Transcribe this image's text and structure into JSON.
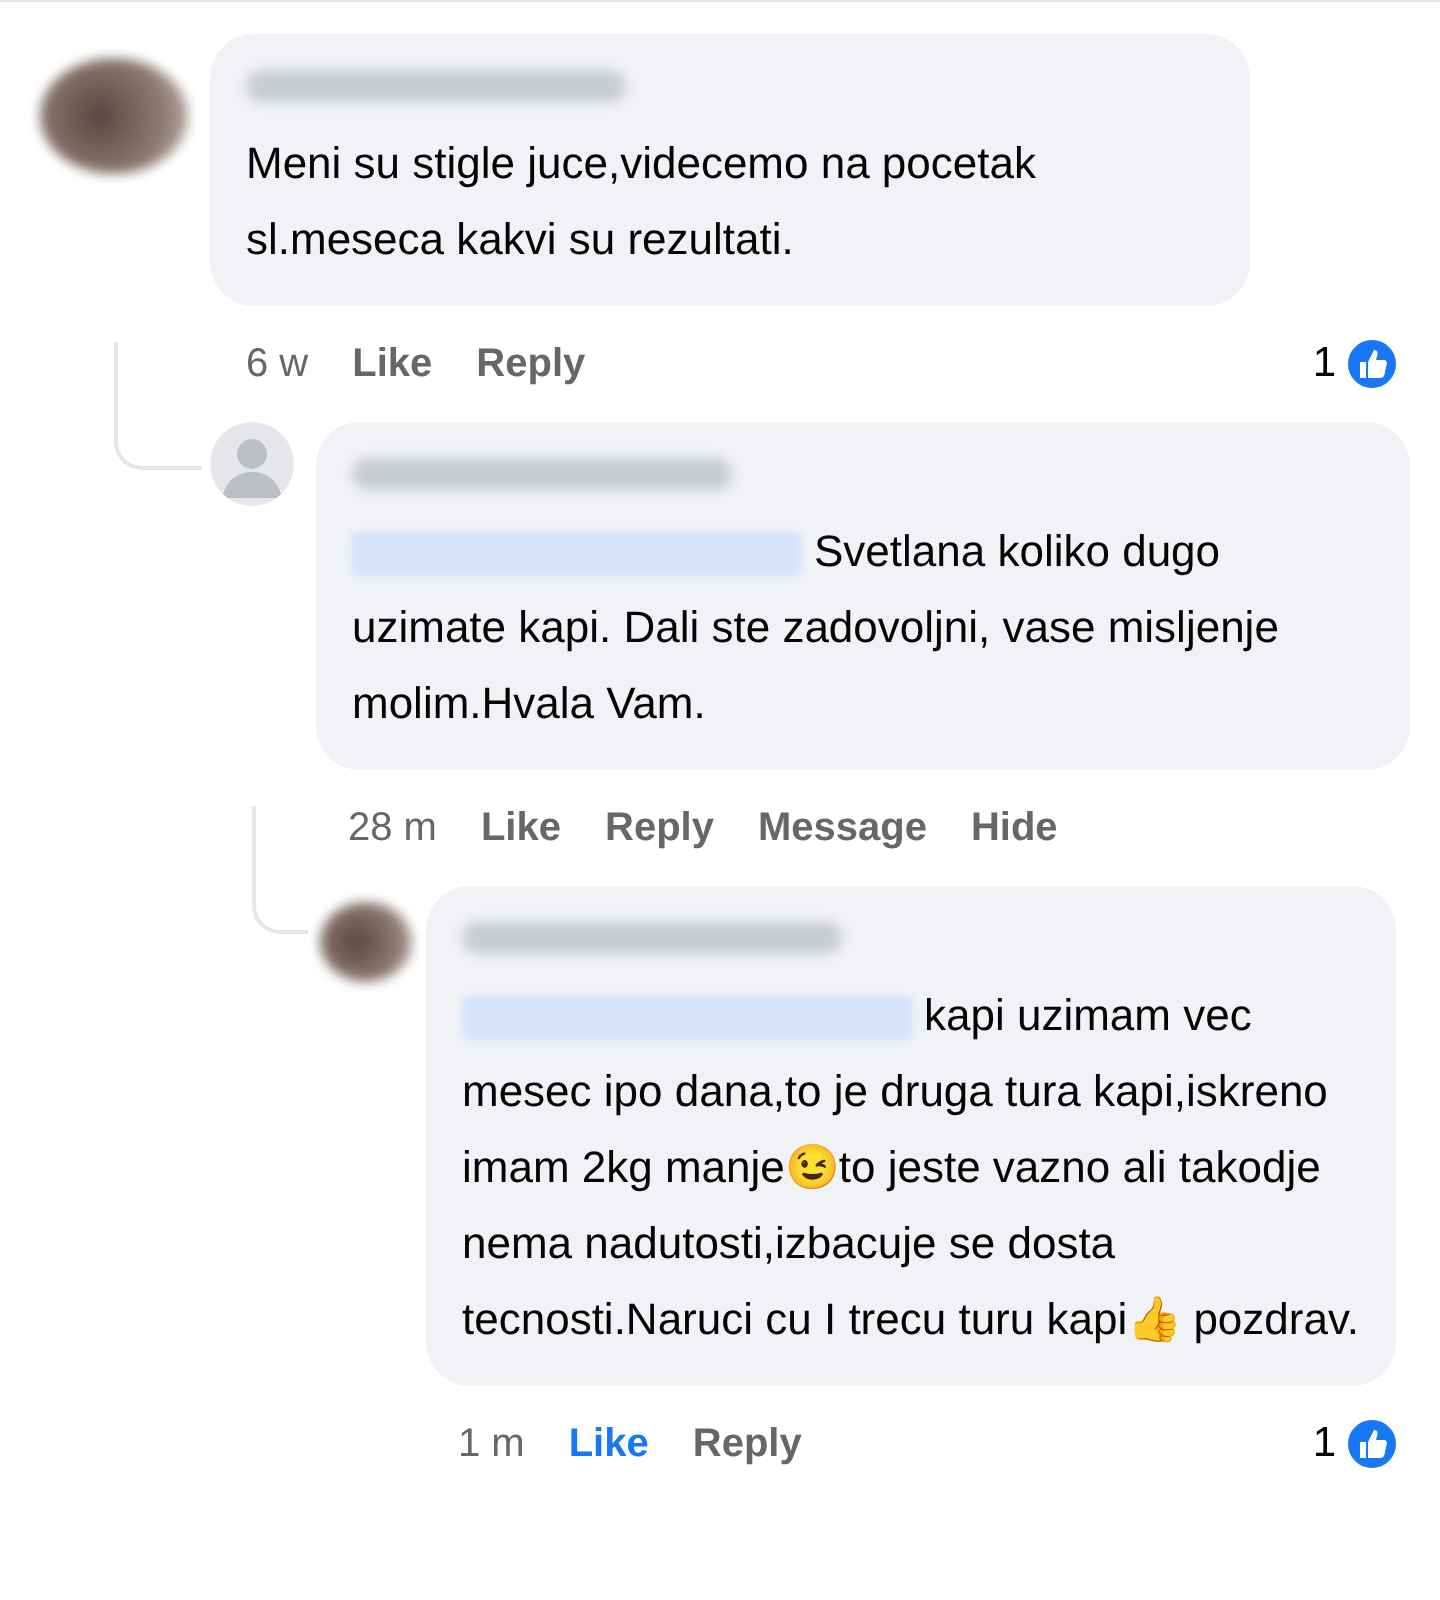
{
  "comments": [
    {
      "default_avatar": false,
      "mention": false,
      "text": "Meni su stigle juce,videcemo na pocetak sl.meseca kakvi su rezultati.",
      "time": "6 w",
      "liked": false,
      "actions": [
        "Like",
        "Reply"
      ],
      "reactions": "1",
      "children": [
        {
          "default_avatar": true,
          "mention": true,
          "text": "Svetlana koliko dugo uzimate kapi. Dali ste zadovoljni, vase misljenje molim.Hvala Vam.",
          "time": "28 m",
          "liked": false,
          "actions": [
            "Like",
            "Reply",
            "Message",
            "Hide"
          ],
          "children": [
            {
              "default_avatar": false,
              "mention": true,
              "text": "kapi uzimam vec mesec ipo dana,to je druga tura kapi,iskreno imam 2kg manje😉to jeste vazno ali takodje nema nadutosti,izbacuje se dosta tecnosti.Naruci cu I trecu turu kapi👍 pozdrav.",
              "time": "1 m",
              "liked": true,
              "actions": [
                "Like",
                "Reply"
              ],
              "reactions": "1"
            }
          ]
        }
      ]
    }
  ]
}
